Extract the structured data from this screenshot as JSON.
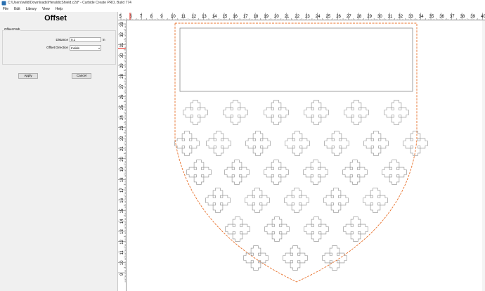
{
  "window": {
    "title": "C:\\Users\\willd\\Downloads\\HeraldicShield.c2d* - Carbide Create PRO, Build 774"
  },
  "menu": [
    "File",
    "Edit",
    "Library",
    "View",
    "Help"
  ],
  "panel": {
    "title": "Offset",
    "group_label": "Offset Path",
    "distance_label": "Distance",
    "distance_value": "0.1",
    "distance_unit": "in",
    "direction_label": "Offset Direction",
    "direction_value": "Inside",
    "apply_label": "Apply",
    "cancel_label": "Cancel"
  },
  "rulers": {
    "top_labels": [
      "5",
      "6",
      "7",
      "8",
      "9",
      "10",
      "11",
      "12",
      "13",
      "14",
      "15",
      "16",
      "17",
      "18",
      "19",
      "20",
      "21",
      "22",
      "23",
      "24",
      "25",
      "26",
      "27",
      "28",
      "29",
      "30",
      "31",
      "32",
      "33",
      "34",
      "35",
      "36",
      "37",
      "38",
      "39",
      "40"
    ],
    "left_labels": [
      "33",
      "32",
      "31",
      "30",
      "29",
      "28",
      "27",
      "26",
      "25",
      "24",
      "23",
      "22",
      "21",
      "20",
      "19",
      "18",
      "17",
      "16",
      "15",
      "14",
      "13",
      "12",
      "11",
      "10",
      "9"
    ]
  },
  "colors": {
    "offset_path": "#e8702a",
    "geometry": "#8a8a8a",
    "ruler_marker": "#e8342a"
  },
  "icons": {
    "app": "carbide-create-icon",
    "scroll": "scrollbar"
  }
}
